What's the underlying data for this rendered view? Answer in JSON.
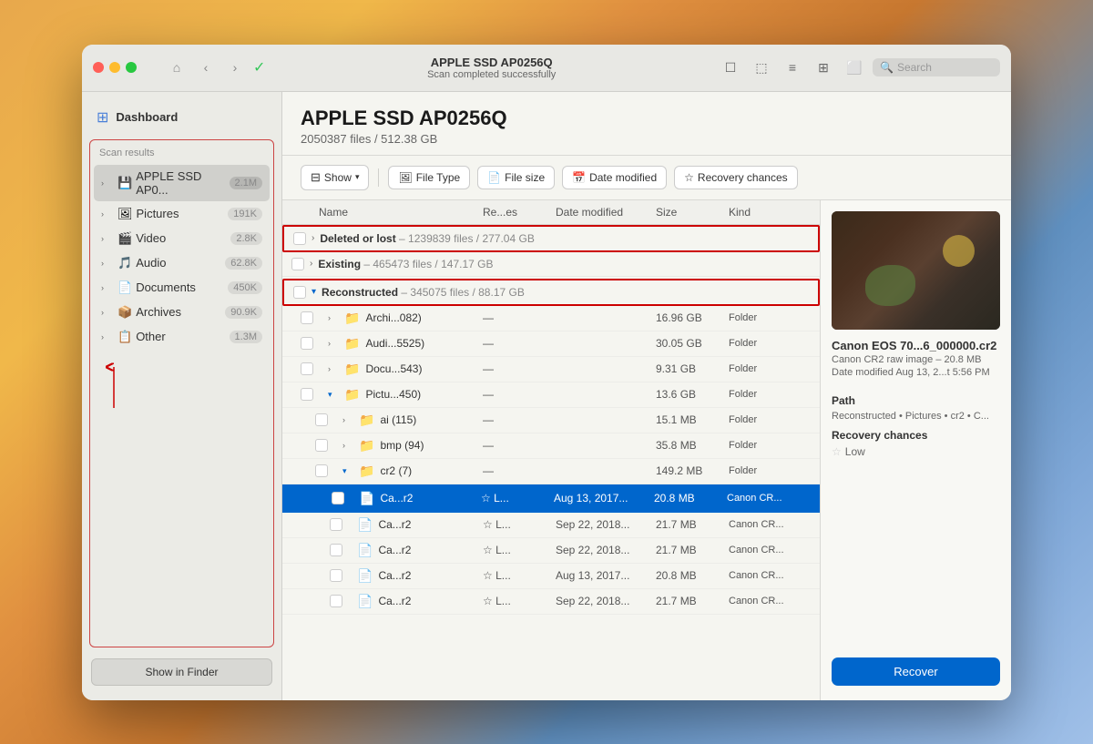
{
  "window": {
    "title": "APPLE SSD AP0256Q",
    "scan_status": "Scan completed successfully"
  },
  "titlebar": {
    "home_label": "⌂",
    "back_label": "‹",
    "forward_label": "›",
    "check_label": "✓",
    "search_placeholder": "Search",
    "icon_file": "☐",
    "icon_folder": "⬚",
    "icon_list": "≡",
    "icon_grid": "⊞",
    "icon_panel": "⬜"
  },
  "sidebar": {
    "dashboard_label": "Dashboard",
    "scan_results_label": "Scan results",
    "items": [
      {
        "id": "apple-ssd",
        "icon": "💾",
        "label": "APPLE SSD AP0...",
        "count": "2.1M",
        "active": true
      },
      {
        "id": "pictures",
        "icon": "🖼",
        "label": "Pictures",
        "count": "191K",
        "active": false
      },
      {
        "id": "video",
        "icon": "🎬",
        "label": "Video",
        "count": "2.8K",
        "active": false
      },
      {
        "id": "audio",
        "icon": "🎵",
        "label": "Audio",
        "count": "62.8K",
        "active": false
      },
      {
        "id": "documents",
        "icon": "📄",
        "label": "Documents",
        "count": "450K",
        "active": false
      },
      {
        "id": "archives",
        "icon": "📦",
        "label": "Archives",
        "count": "90.9K",
        "active": false
      },
      {
        "id": "other",
        "icon": "📋",
        "label": "Other",
        "count": "1.3M",
        "active": false
      }
    ],
    "show_in_finder": "Show in Finder"
  },
  "content": {
    "drive_title": "APPLE SSD AP0256Q",
    "drive_subtitle": "2050387 files / 512.38 GB",
    "filters": {
      "show_label": "Show",
      "file_type_label": "File Type",
      "file_size_label": "File size",
      "date_modified_label": "Date modified",
      "recovery_chances_label": "Recovery chances"
    },
    "columns": {
      "name": "Name",
      "recs": "Re...es",
      "date_modified": "Date modified",
      "size": "Size",
      "kind": "Kind"
    },
    "groups": [
      {
        "id": "deleted",
        "expanded": false,
        "label": "Deleted or lost",
        "info": " – 1239839 files / 277.04 GB",
        "highlight": true
      },
      {
        "id": "existing",
        "expanded": false,
        "label": "Existing",
        "info": " – 465473 files / 147.17 GB",
        "highlight": false
      },
      {
        "id": "reconstructed",
        "expanded": true,
        "label": "Reconstructed",
        "info": " – 345075 files / 88.17 GB",
        "highlight": true
      }
    ],
    "files": [
      {
        "id": "archi",
        "indent": 1,
        "type": "folder",
        "name": "Archi...082)",
        "recs": "—",
        "date": "",
        "size": "16.96 GB",
        "kind": "Folder",
        "selected": false,
        "expanded": false
      },
      {
        "id": "audi",
        "indent": 1,
        "type": "folder",
        "name": "Audi...5525)",
        "recs": "—",
        "date": "",
        "size": "30.05 GB",
        "kind": "Folder",
        "selected": false,
        "expanded": false
      },
      {
        "id": "docu",
        "indent": 1,
        "type": "folder",
        "name": "Docu...543)",
        "recs": "—",
        "date": "",
        "size": "9.31 GB",
        "kind": "Folder",
        "selected": false,
        "expanded": false
      },
      {
        "id": "pictu",
        "indent": 1,
        "type": "folder",
        "name": "Pictu...450)",
        "recs": "—",
        "date": "",
        "size": "13.6 GB",
        "kind": "Folder",
        "selected": false,
        "expanded": true
      },
      {
        "id": "ai",
        "indent": 2,
        "type": "folder",
        "name": "ai (115)",
        "recs": "—",
        "date": "",
        "size": "15.1 MB",
        "kind": "Folder",
        "selected": false,
        "expanded": false
      },
      {
        "id": "bmp",
        "indent": 2,
        "type": "folder",
        "name": "bmp (94)",
        "recs": "—",
        "date": "",
        "size": "35.8 MB",
        "kind": "Folder",
        "selected": false,
        "expanded": false
      },
      {
        "id": "cr2",
        "indent": 2,
        "type": "folder",
        "name": "cr2 (7)",
        "recs": "—",
        "date": "",
        "size": "149.2 MB",
        "kind": "Folder",
        "selected": false,
        "expanded": true
      },
      {
        "id": "cr2-file1",
        "indent": 3,
        "type": "file",
        "name": "Ca...r2",
        "recs": "L...",
        "date": "Aug 13, 2017...",
        "size": "20.8 MB",
        "kind": "Canon CR...",
        "selected": true
      },
      {
        "id": "cr2-file2",
        "indent": 3,
        "type": "file",
        "name": "Ca...r2",
        "recs": "L...",
        "date": "Sep 22, 2018...",
        "size": "21.7 MB",
        "kind": "Canon CR...",
        "selected": false
      },
      {
        "id": "cr2-file3",
        "indent": 3,
        "type": "file",
        "name": "Ca...r2",
        "recs": "L...",
        "date": "Sep 22, 2018...",
        "size": "21.7 MB",
        "kind": "Canon CR...",
        "selected": false
      },
      {
        "id": "cr2-file4",
        "indent": 3,
        "type": "file",
        "name": "Ca...r2",
        "recs": "L...",
        "date": "Aug 13, 2017...",
        "size": "20.8 MB",
        "kind": "Canon CR...",
        "selected": false
      },
      {
        "id": "cr2-file5",
        "indent": 3,
        "type": "file",
        "name": "Ca...r2",
        "recs": "L...",
        "date": "Sep 22, 2018...",
        "size": "21.7 MB",
        "kind": "Canon CR...",
        "selected": false
      }
    ]
  },
  "right_panel": {
    "file_name": "Canon EOS 70...6_000000.cr2",
    "file_type": "Canon CR2 raw image – 20.8 MB",
    "date_modified": "Date modified Aug 13, 2...t 5:56 PM",
    "path_label": "Path",
    "path_value": "Reconstructed • Pictures • cr2 • C...",
    "recovery_chances_label": "Recovery chances",
    "recovery_chances_value": "Low",
    "recover_button": "Recover"
  }
}
